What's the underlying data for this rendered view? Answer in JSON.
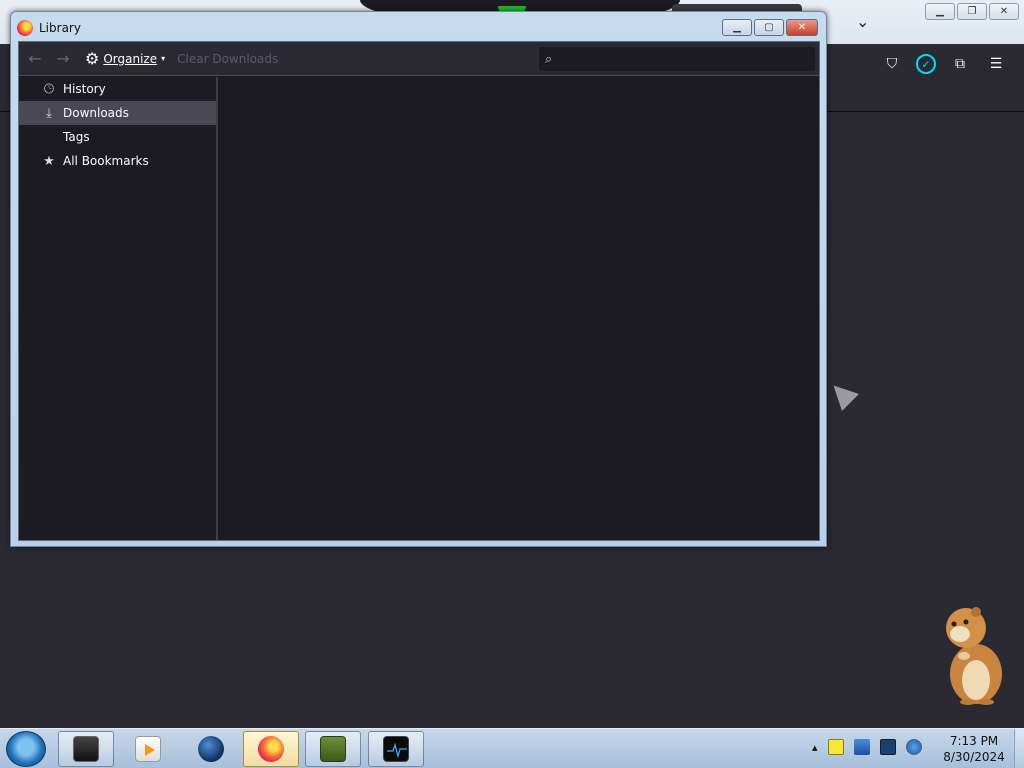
{
  "background_window": {
    "toolbar_icons": [
      "pocket-icon",
      "sync-account-icon",
      "extensions-icon",
      "menu-icon"
    ]
  },
  "library": {
    "title": "Library",
    "toolbar": {
      "back": "←",
      "forward": "→",
      "organize_label": "Organize",
      "clear_downloads_label": "Clear Downloads",
      "search_placeholder": ""
    },
    "sidebar": {
      "items": [
        {
          "label": "History",
          "icon": "clock-icon"
        },
        {
          "label": "Downloads",
          "icon": "download-icon",
          "selected": true
        },
        {
          "label": "Tags",
          "icon": ""
        },
        {
          "label": "All Bookmarks",
          "icon": "star-icon"
        }
      ]
    }
  },
  "taskbar": {
    "apps": [
      "terminal-app",
      "media-player-app",
      "globe-app",
      "firefox-app",
      "game-box-app",
      "monitor-app"
    ],
    "clock": {
      "time": "7:13 PM",
      "date": "8/30/2024"
    }
  }
}
